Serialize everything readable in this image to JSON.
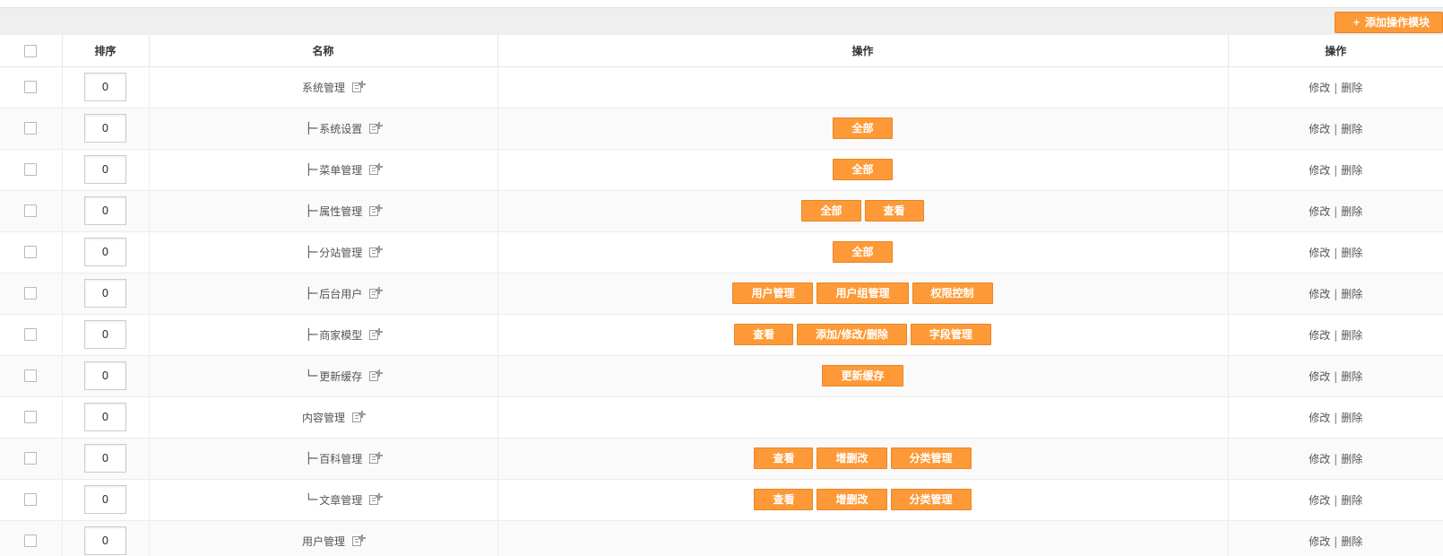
{
  "toolbar": {
    "add_module_label": "添加操作模块",
    "add_module_icon": "plus-icon"
  },
  "table": {
    "headers": {
      "sort": "排序",
      "name": "名称",
      "ops": "操作",
      "actions": "操作"
    },
    "edit_label": "修改",
    "separator": "|",
    "delete_label": "删除",
    "rows": [
      {
        "sort": "0",
        "prefix": "",
        "name": "系统管理",
        "buttons": []
      },
      {
        "sort": "0",
        "prefix": "├─",
        "name": "系统设置",
        "buttons": [
          "全部"
        ]
      },
      {
        "sort": "0",
        "prefix": "├─",
        "name": "菜单管理",
        "buttons": [
          "全部"
        ]
      },
      {
        "sort": "0",
        "prefix": "├─",
        "name": "属性管理",
        "buttons": [
          "全部",
          "查看"
        ]
      },
      {
        "sort": "0",
        "prefix": "├─",
        "name": "分站管理",
        "buttons": [
          "全部"
        ]
      },
      {
        "sort": "0",
        "prefix": "├─",
        "name": "后台用户",
        "buttons": [
          "用户管理",
          "用户组管理",
          "权限控制"
        ]
      },
      {
        "sort": "0",
        "prefix": "├─",
        "name": "商家模型",
        "buttons": [
          "查看",
          "添加/修改/删除",
          "字段管理"
        ]
      },
      {
        "sort": "0",
        "prefix": "└─",
        "name": "更新缓存",
        "buttons": [
          "更新缓存"
        ]
      },
      {
        "sort": "0",
        "prefix": "",
        "name": "内容管理",
        "buttons": []
      },
      {
        "sort": "0",
        "prefix": "├─",
        "name": "百科管理",
        "buttons": [
          "查看",
          "增删改",
          "分类管理"
        ]
      },
      {
        "sort": "0",
        "prefix": "└─",
        "name": "文章管理",
        "buttons": [
          "查看",
          "增删改",
          "分类管理"
        ]
      },
      {
        "sort": "0",
        "prefix": "",
        "name": "用户管理",
        "buttons": []
      }
    ]
  },
  "colors": {
    "accent": "#fd9a37",
    "accent_border": "#e98526"
  }
}
